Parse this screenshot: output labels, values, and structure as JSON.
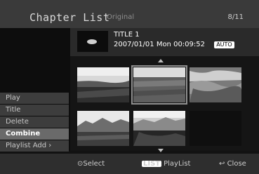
{
  "header": {
    "title": "Chapter List",
    "subtitle": "Original",
    "page_count": "8/11"
  },
  "info": {
    "title": "TITLE 1",
    "meta": "2007/01/01 Mon 00:09:52",
    "badge": "AUTO"
  },
  "menu": {
    "items": [
      {
        "label": "Play"
      },
      {
        "label": "Title"
      },
      {
        "label": "Delete"
      },
      {
        "label": "Combine",
        "active": true
      },
      {
        "label": "Playlist Add ›"
      }
    ]
  },
  "footer": {
    "select": "⊙Select",
    "list_badge": "LIST",
    "playlist": "PlayList",
    "close": "Close",
    "close_icon": "return-icon"
  },
  "thumbnails": {
    "selected_index": 1,
    "count": 6
  },
  "colors": {
    "header_bg": "#3a3a3a",
    "menu_bg": "#3d3d3d",
    "menu_active_bg": "#6a6a6a",
    "footer_bg": "#2e2e2e"
  }
}
